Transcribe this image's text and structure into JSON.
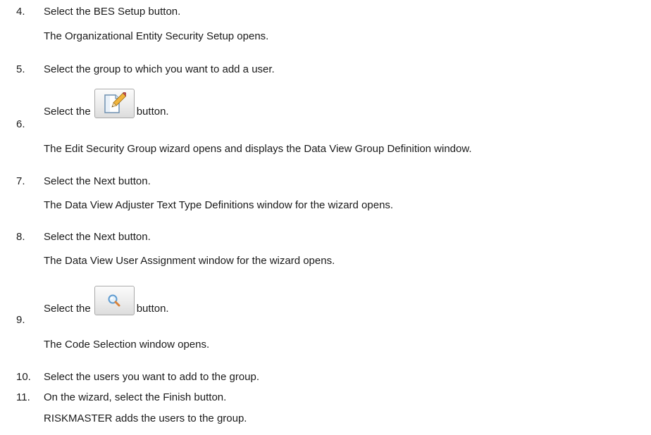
{
  "steps": [
    {
      "number": "4.",
      "text": "Select the BES Setup button.",
      "result": "The Organizational Entity Security Setup opens."
    },
    {
      "number": "5.",
      "text": "Select the group to which you want to add a user."
    },
    {
      "number": "6.",
      "text_before": "Select the",
      "text_after": "button.",
      "icon": "edit-icon",
      "result": "The Edit Security Group wizard opens and displays the Data View Group Definition window."
    },
    {
      "number": "7.",
      "text": "Select the Next button.",
      "result": "The Data View Adjuster Text Type Definitions window for the wizard opens."
    },
    {
      "number": "8.",
      "text": "Select the Next button.",
      "result": "The Data View User Assignment window for the wizard opens."
    },
    {
      "number": "9.",
      "text_before": "Select the",
      "text_after": "button.",
      "icon": "search-icon",
      "result": "The Code Selection window opens."
    },
    {
      "number": "10.",
      "text": "Select the users you want to add to the group."
    },
    {
      "number": "11.",
      "text": "On the wizard, select the Finish button.",
      "result": "RISKMASTER adds the users to the group."
    }
  ]
}
